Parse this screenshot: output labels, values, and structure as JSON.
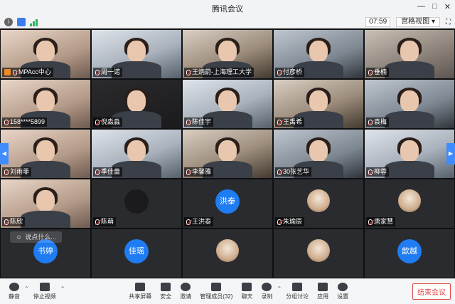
{
  "window": {
    "title": "腾讯会议"
  },
  "infobar": {
    "time": "07:59",
    "view_mode": "宫格视图"
  },
  "participants": [
    {
      "name": "MPAcc中心",
      "type": "video",
      "host": true
    },
    {
      "name": "周一诺",
      "type": "video"
    },
    {
      "name": "王炳蔚-上海理工大学",
      "type": "video"
    },
    {
      "name": "付彦桥",
      "type": "video"
    },
    {
      "name": "垂楠",
      "type": "video"
    },
    {
      "name": "158****5899",
      "type": "video"
    },
    {
      "name": "倪淼淼",
      "type": "video"
    },
    {
      "name": "陈佳宇",
      "type": "video"
    },
    {
      "name": "王禹希",
      "type": "video"
    },
    {
      "name": "袁梅",
      "type": "video"
    },
    {
      "name": "刘雨菲",
      "type": "video"
    },
    {
      "name": "季佳蕾",
      "type": "video"
    },
    {
      "name": "李馨雅",
      "type": "video"
    },
    {
      "name": "30张艺华",
      "type": "video"
    },
    {
      "name": "柳蓉",
      "type": "video"
    },
    {
      "name": "陈欣",
      "type": "video"
    },
    {
      "name": "陈萌",
      "type": "avatar-dark"
    },
    {
      "name": "王洪泰",
      "type": "avatar",
      "avatar_text": "洪泰"
    },
    {
      "name": "朱瑜辰",
      "type": "avatar-photo"
    },
    {
      "name": "唐家慧",
      "type": "avatar-photo"
    },
    {
      "name": "",
      "type": "avatar",
      "avatar_text": "书婷"
    },
    {
      "name": "",
      "type": "avatar",
      "avatar_text": "佳瑶"
    },
    {
      "name": "",
      "type": "avatar-photo"
    },
    {
      "name": "",
      "type": "avatar-photo"
    },
    {
      "name": "",
      "type": "avatar",
      "avatar_text": "歆越"
    }
  ],
  "chat_input": {
    "placeholder": "说点什么..."
  },
  "toolbar": {
    "mute": "静音",
    "video": "停止视频",
    "share": "共享屏幕",
    "security": "安全",
    "invite": "邀请",
    "members": "管理成员(32)",
    "chat": "聊天",
    "record": "录制",
    "breakout": "分组讨论",
    "apps": "应用",
    "settings": "设置",
    "end": "结束会议"
  },
  "colors": {
    "accent": "#1f7cf2",
    "end": "#e04848"
  }
}
